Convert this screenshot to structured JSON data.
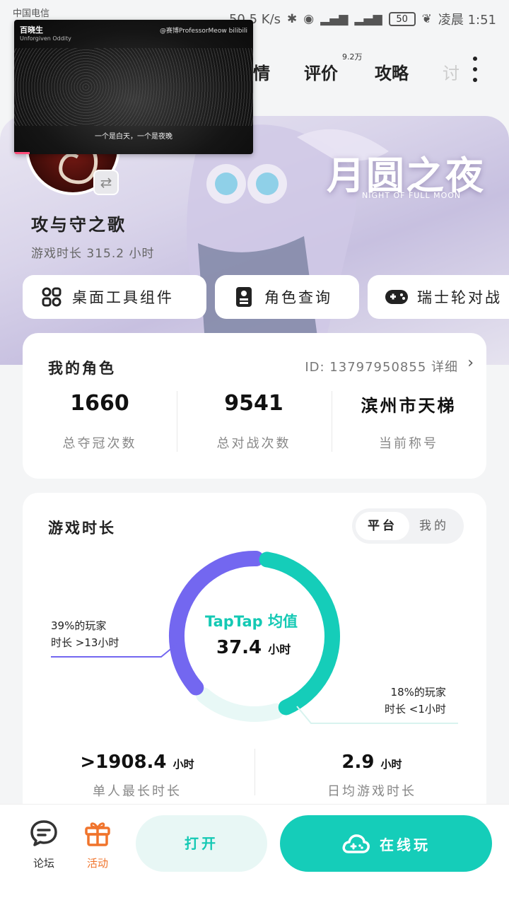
{
  "status_bar": {
    "carrier": "中国电信",
    "net_speed": "50.5 K/s",
    "battery": "50",
    "time": "凌晨 1:51"
  },
  "nav": {
    "tabs": [
      "情",
      "评价",
      "攻略",
      "讨"
    ],
    "review_count": "9.2万"
  },
  "video": {
    "channel": "百晓生",
    "channel_sub": "Unforgiven Oddity",
    "watermark": "@赛博ProfessorMeow bilibili",
    "subtitle": "一个是白天，一个是夜晚"
  },
  "hero": {
    "logo_text": "月圆之夜",
    "logo_sub": "NIGHT OF FULL MOON",
    "game_name": "攻与守之歌",
    "play_time": "游戏时长 315.2 小时"
  },
  "chips": [
    {
      "label": "桌面工具组件",
      "icon": "grid-icon"
    },
    {
      "label": "角色查询",
      "icon": "id-card-icon"
    },
    {
      "label": "瑞士轮对战",
      "icon": "gamepad-icon"
    }
  ],
  "role": {
    "title": "我的角色",
    "id_text": "ID: 13797950855 详细",
    "stats": [
      {
        "value": "1660",
        "label": "总夺冠次数"
      },
      {
        "value": "9541",
        "label": "总对战次数"
      },
      {
        "value": "滨州市天梯",
        "label": "当前称号"
      }
    ]
  },
  "playtime_card": {
    "title": "游戏时长",
    "toggle": {
      "active": "平台",
      "inactive": "我的"
    },
    "center_brand": "TapTap 均值",
    "center_value": "37.4",
    "center_unit": "小时",
    "ann_left_1": "39%的玩家",
    "ann_left_2": "时长 >13小时",
    "ann_right_1": "18%的玩家",
    "ann_right_2": "时长 <1小时",
    "longest_value": ">1908.4",
    "longest_unit": "小时",
    "longest_label": "单人最长时长",
    "daily_value": "2.9",
    "daily_unit": "小时",
    "daily_label": "日均游戏时长"
  },
  "chart_data": {
    "type": "pie",
    "segments": [
      {
        "label": "39%的玩家 时长 >13小时",
        "value": 39,
        "color": "#7367f0"
      },
      {
        "label": "",
        "value": 43,
        "color": "#15cdb9"
      },
      {
        "label": "18%的玩家 时长 <1小时",
        "value": 18,
        "color": "#e8f8f6"
      }
    ]
  },
  "bottom_bar": {
    "forum": "论坛",
    "activity": "活动",
    "open": "打开",
    "play_online": "在线玩"
  },
  "colors": {
    "accent": "#15cdb9",
    "purple": "#7367f0",
    "activity_orange": "#f0742c"
  }
}
